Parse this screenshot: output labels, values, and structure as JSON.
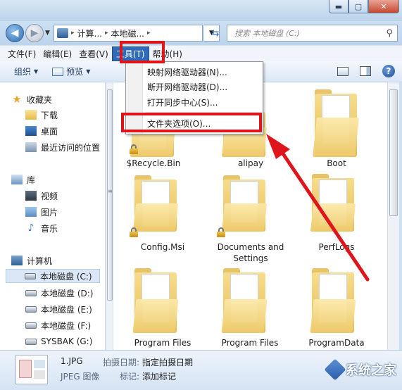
{
  "window": {
    "min_glyph": "▬",
    "max_glyph": "▢",
    "close_glyph": "✕"
  },
  "address": {
    "seg1": "计算...",
    "seg2": "本地磁...",
    "arrow": "▸",
    "search_placeholder": "搜索 本地磁盘 (C:)"
  },
  "menubar": {
    "items": [
      "文件(F)",
      "编辑(E)",
      "查看(V)",
      "工具(T)",
      "帮助(H)"
    ]
  },
  "toolbar": {
    "organize": "组织",
    "preview": "预览"
  },
  "tools_menu": {
    "items": [
      "映射网络驱动器(N)...",
      "断开网络驱动器(D)...",
      "打开同步中心(S)...",
      "文件夹选项(O)..."
    ]
  },
  "nav": {
    "favorites": "收藏夹",
    "downloads": "下载",
    "desktop": "桌面",
    "recent": "最近访问的位置",
    "libraries": "库",
    "videos": "视频",
    "pictures": "图片",
    "music": "音乐",
    "computer": "计算机",
    "drive_c": "本地磁盘 (C:)",
    "drive_d": "本地磁盘 (D:)",
    "drive_e": "本地磁盘 (E:)",
    "drive_f": "本地磁盘 (F:)",
    "drive_g": "SYSBAK (G:)"
  },
  "files": [
    {
      "name": "$Recycle.Bin",
      "locked": true
    },
    {
      "name": "alipay",
      "locked": false
    },
    {
      "name": "Boot",
      "locked": false
    },
    {
      "name": "Config.Msi",
      "locked": true
    },
    {
      "name": "Documents and Settings",
      "locked": true
    },
    {
      "name": "PerfLogs",
      "locked": false
    },
    {
      "name": "Program Files",
      "locked": false
    },
    {
      "name": "Program Files",
      "locked": false
    },
    {
      "name": "ProgramData",
      "locked": false
    }
  ],
  "details": {
    "filename": "1.JPG",
    "filetype": "JPEG 图像",
    "date_label": "拍摄日期:",
    "date_value": "指定拍摄日期",
    "tag_label": "标记:",
    "tag_value": "添加标记"
  },
  "watermark": {
    "text": "系统之家"
  },
  "colors": {
    "highlight_red": "#e0141b",
    "menu_active": "#2f6bb7"
  }
}
